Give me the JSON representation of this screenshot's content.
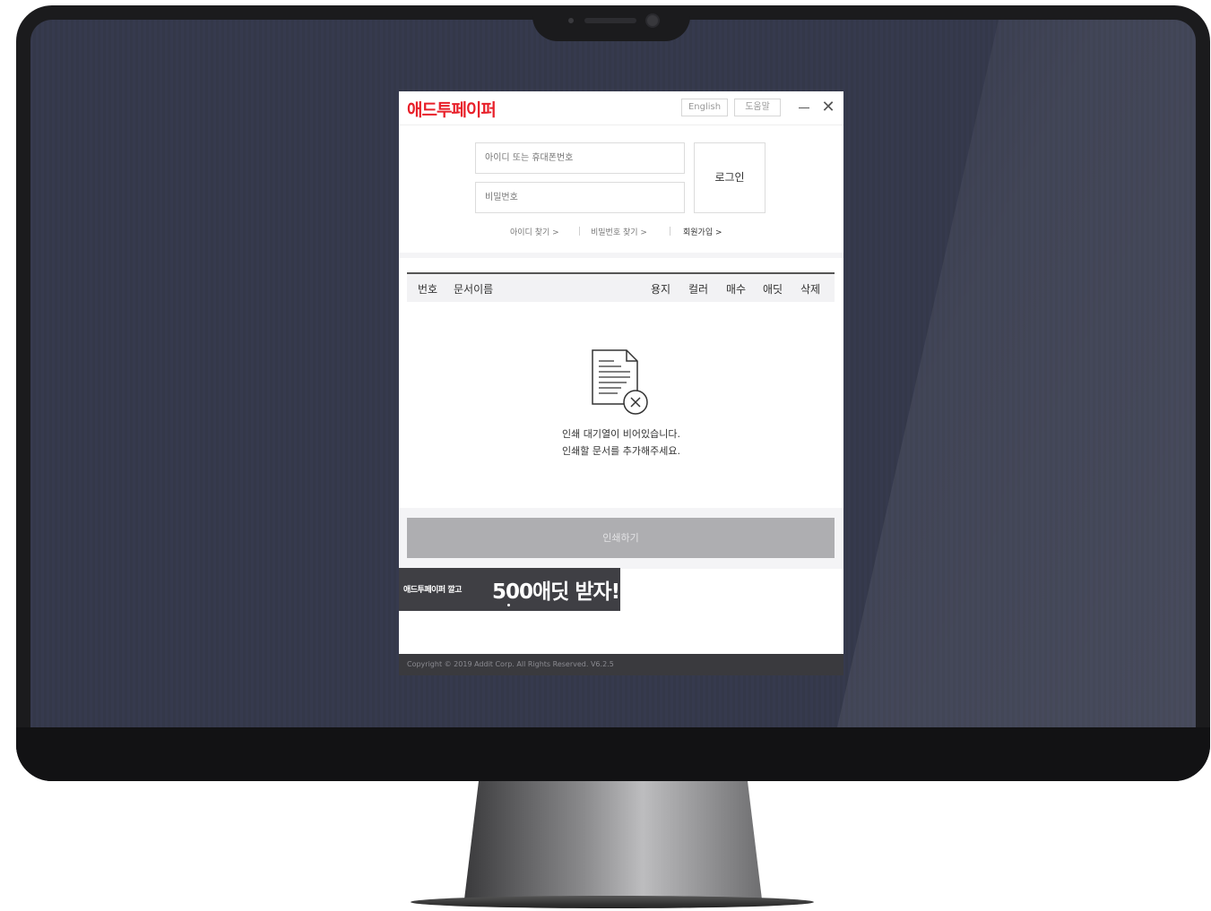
{
  "app": {
    "brand": "애드투페이퍼",
    "lang_button": "English",
    "help_button": "도움말",
    "close_glyph": "✕"
  },
  "login": {
    "id_placeholder": "아이디 또는 휴대폰번호",
    "pw_placeholder": "비밀번호",
    "login_button": "로그인",
    "links": {
      "find_id": "아이디 찾기 >",
      "find_pw": "비밀번호 찾기 >",
      "signup": "회원가입 >"
    }
  },
  "table": {
    "headers": {
      "num": "번호",
      "name": "문서이름",
      "paper": "용지",
      "color": "컬러",
      "count": "매수",
      "points": "애딧",
      "delete": "삭제"
    }
  },
  "empty": {
    "line1": "인쇄 대기열이 비어있습니다.",
    "line2": "인쇄할 문서를 추가해주세요."
  },
  "print_button": "인쇄하기",
  "banner": {
    "small": "애드투페이퍼 깔고",
    "big": "500애딧 받자!"
  },
  "footer": "Copyright © 2019 Addit Corp. All Rights Reserved. V6.2.5",
  "colors": {
    "brand": "#e8202a",
    "screen": "#363a4e",
    "print_button": "#aeaeb1",
    "banner": "#3f3f44",
    "footer": "#3a3a3e"
  },
  "icons": [
    "document-error-icon",
    "minimize-icon",
    "close-icon"
  ]
}
